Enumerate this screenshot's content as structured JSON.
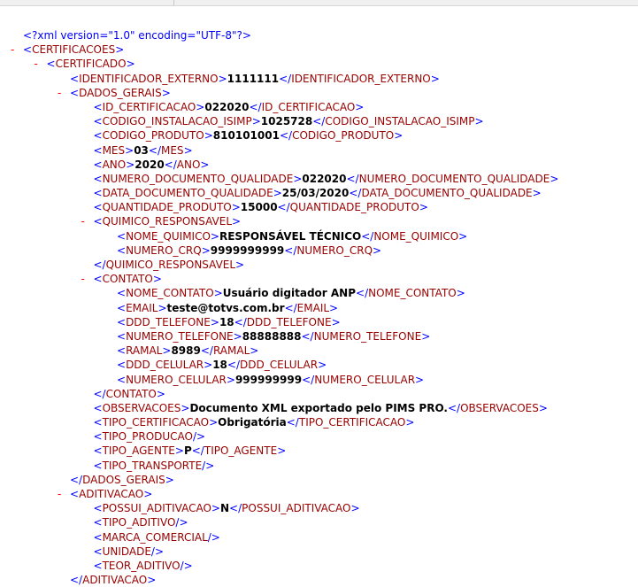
{
  "declaration": "<?xml version=\"1.0\" encoding=\"UTF-8\"?>",
  "collapse_symbol": "-",
  "lines": [
    {
      "depth": 0,
      "kind": "open",
      "tag": "CERTIFICACOES",
      "toggle": true
    },
    {
      "depth": 1,
      "kind": "open",
      "tag": "CERTIFICADO",
      "toggle": true
    },
    {
      "depth": 2,
      "kind": "leaf",
      "tag": "IDENTIFICADOR_EXTERNO",
      "value": "1111111"
    },
    {
      "depth": 2,
      "kind": "open",
      "tag": "DADOS_GERAIS",
      "toggle": true
    },
    {
      "depth": 3,
      "kind": "leaf",
      "tag": "ID_CERTIFICACAO",
      "value": "022020"
    },
    {
      "depth": 3,
      "kind": "leaf",
      "tag": "CODIGO_INSTALACAO_ISIMP",
      "value": "1025728"
    },
    {
      "depth": 3,
      "kind": "leaf",
      "tag": "CODIGO_PRODUTO",
      "value": "810101001"
    },
    {
      "depth": 3,
      "kind": "leaf",
      "tag": "MES",
      "value": "03"
    },
    {
      "depth": 3,
      "kind": "leaf",
      "tag": "ANO",
      "value": "2020"
    },
    {
      "depth": 3,
      "kind": "leaf",
      "tag": "NUMERO_DOCUMENTO_QUALIDADE",
      "value": "022020"
    },
    {
      "depth": 3,
      "kind": "leaf",
      "tag": "DATA_DOCUMENTO_QUALIDADE",
      "value": "25/03/2020"
    },
    {
      "depth": 3,
      "kind": "leaf",
      "tag": "QUANTIDADE_PRODUTO",
      "value": "15000"
    },
    {
      "depth": 3,
      "kind": "open",
      "tag": "QUIMICO_RESPONSAVEL",
      "toggle": true
    },
    {
      "depth": 4,
      "kind": "leaf",
      "tag": "NOME_QUIMICO",
      "value": "RESPONSÁVEL TÉCNICO"
    },
    {
      "depth": 4,
      "kind": "leaf",
      "tag": "NUMERO_CRQ",
      "value": "9999999999"
    },
    {
      "depth": 3,
      "kind": "close",
      "tag": "QUIMICO_RESPONSAVEL"
    },
    {
      "depth": 3,
      "kind": "open",
      "tag": "CONTATO",
      "toggle": true
    },
    {
      "depth": 4,
      "kind": "leaf",
      "tag": "NOME_CONTATO",
      "value": "Usuário digitador ANP"
    },
    {
      "depth": 4,
      "kind": "leaf",
      "tag": "EMAIL",
      "value": "teste@totvs.com.br"
    },
    {
      "depth": 4,
      "kind": "leaf",
      "tag": "DDD_TELEFONE",
      "value": "18"
    },
    {
      "depth": 4,
      "kind": "leaf",
      "tag": "NUMERO_TELEFONE",
      "value": "88888888"
    },
    {
      "depth": 4,
      "kind": "leaf",
      "tag": "RAMAL",
      "value": "8989"
    },
    {
      "depth": 4,
      "kind": "leaf",
      "tag": "DDD_CELULAR",
      "value": "18"
    },
    {
      "depth": 4,
      "kind": "leaf",
      "tag": "NUMERO_CELULAR",
      "value": "999999999"
    },
    {
      "depth": 3,
      "kind": "close",
      "tag": "CONTATO"
    },
    {
      "depth": 3,
      "kind": "leaf",
      "tag": "OBSERVACOES",
      "value": "Documento XML exportado pelo PIMS PRO."
    },
    {
      "depth": 3,
      "kind": "leaf",
      "tag": "TIPO_CERTIFICACAO",
      "value": "Obrigatória"
    },
    {
      "depth": 3,
      "kind": "empty",
      "tag": "TIPO_PRODUCAO"
    },
    {
      "depth": 3,
      "kind": "leaf",
      "tag": "TIPO_AGENTE",
      "value": "P"
    },
    {
      "depth": 3,
      "kind": "empty",
      "tag": "TIPO_TRANSPORTE"
    },
    {
      "depth": 2,
      "kind": "close",
      "tag": "DADOS_GERAIS"
    },
    {
      "depth": 2,
      "kind": "open",
      "tag": "ADITIVACAO",
      "toggle": true
    },
    {
      "depth": 3,
      "kind": "leaf",
      "tag": "POSSUI_ADITIVACAO",
      "value": "N"
    },
    {
      "depth": 3,
      "kind": "empty",
      "tag": "TIPO_ADITIVO"
    },
    {
      "depth": 3,
      "kind": "empty",
      "tag": "MARCA_COMERCIAL"
    },
    {
      "depth": 3,
      "kind": "empty",
      "tag": "UNIDADE"
    },
    {
      "depth": 3,
      "kind": "empty",
      "tag": "TEOR_ADITIVO"
    },
    {
      "depth": 2,
      "kind": "close",
      "tag": "ADITIVACAO"
    }
  ]
}
